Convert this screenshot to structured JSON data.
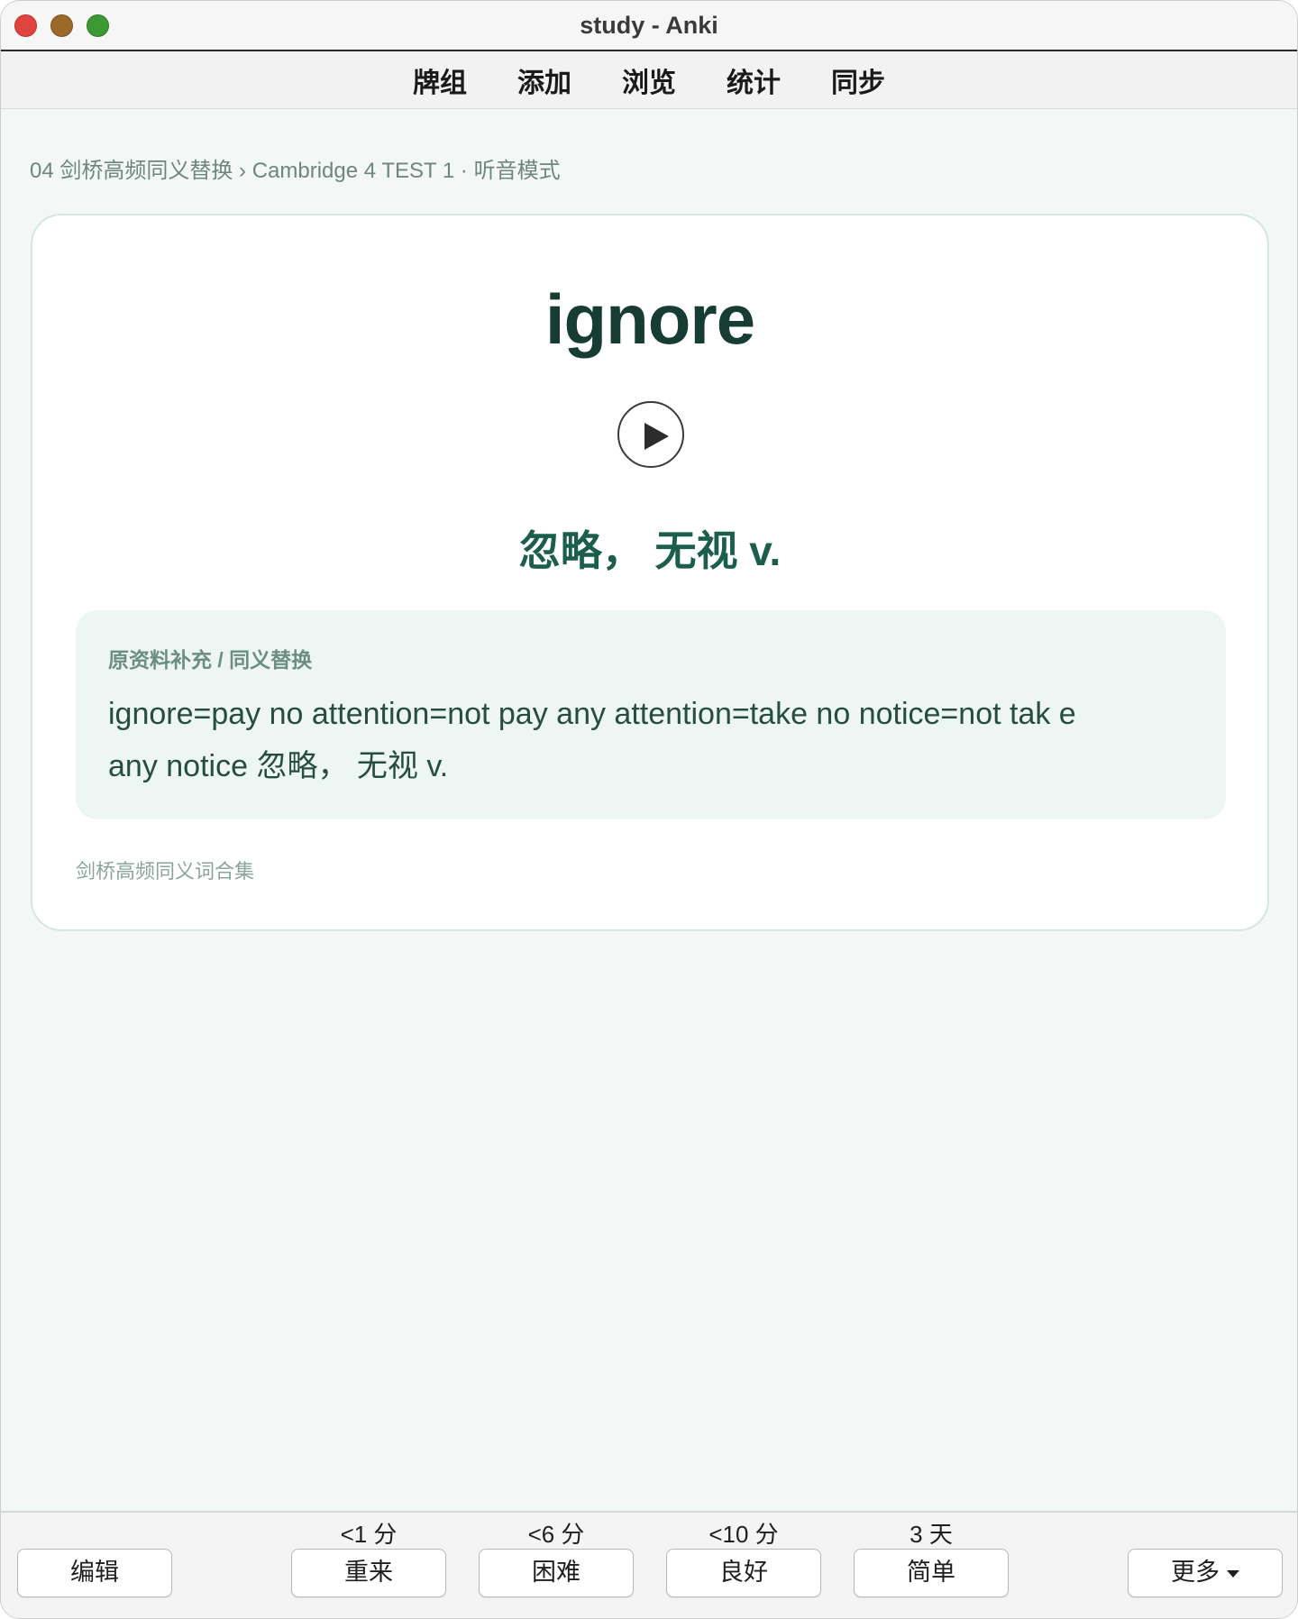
{
  "window": {
    "title": "study - Anki"
  },
  "topnav": {
    "items": [
      {
        "label": "牌组"
      },
      {
        "label": "添加"
      },
      {
        "label": "浏览"
      },
      {
        "label": "统计"
      },
      {
        "label": "同步"
      }
    ]
  },
  "breadcrumb": "04 剑桥高频同义替换 › Cambridge 4 TEST 1 · 听音模式",
  "card": {
    "word": "ignore",
    "meaning": "忽略， 无视 v.",
    "note": {
      "label": "原资料补充 / 同义替换",
      "text_line1": "ignore=pay no attention=not pay any attention=take no notice=not tak e",
      "text_line2": "any notice 忽略， 无视 v."
    },
    "source": "剑桥高频同义词合集",
    "play_icon": "play-icon"
  },
  "bottombar": {
    "edit_label": "编辑",
    "more_label": "更多",
    "answers": [
      {
        "label": "重来",
        "interval": "<1 分"
      },
      {
        "label": "困难",
        "interval": "<6 分"
      },
      {
        "label": "良好",
        "interval": "<10 分"
      },
      {
        "label": "简单",
        "interval": "3 天"
      }
    ]
  },
  "colors": {
    "background": "#f3f8f6",
    "word": "#163c34",
    "meaning": "#1b5e4c",
    "note_bg": "#edf6f2"
  }
}
